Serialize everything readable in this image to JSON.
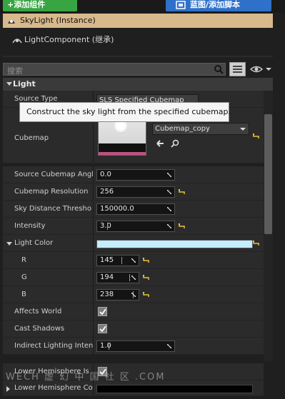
{
  "toolbar": {
    "add_component_label": "+添加组件",
    "blueprint_label": "蓝图/添加脚本"
  },
  "components": [
    {
      "label": "SkyLight (Instance)",
      "icon": "skylight-icon"
    },
    {
      "label": "LightComponent (继承)",
      "icon": "light-component-icon"
    }
  ],
  "search": {
    "placeholder": "搜索"
  },
  "section": {
    "title": "Light"
  },
  "source_type": {
    "label": "Source Type",
    "value": "SLS Specified Cubemap"
  },
  "tooltip": "Construct the sky light from the specified cubemap.",
  "cubemap": {
    "label": "Cubemap",
    "asset": "Cubemap_copy"
  },
  "properties": [
    {
      "label": "Source Cubemap Angl",
      "value": "0.0",
      "reset": false
    },
    {
      "label": "Cubemap Resolution",
      "value": "256",
      "reset": true
    },
    {
      "label": "Sky Distance Thresho",
      "value": "150000.0",
      "reset": false
    },
    {
      "label": "Intensity",
      "value": "3.0",
      "reset": true
    }
  ],
  "light_color": {
    "label": "Light Color",
    "color": "#C2EEFF",
    "channels": [
      {
        "label": "R",
        "value": "145"
      },
      {
        "label": "G",
        "value": "194"
      },
      {
        "label": "B",
        "value": "238"
      }
    ]
  },
  "checks": [
    {
      "label": "Affects World",
      "checked": true
    },
    {
      "label": "Cast Shadows",
      "checked": true
    }
  ],
  "indirect": {
    "label": "Indirect Lighting Inten",
    "value": "1.0"
  },
  "lower_hemi": {
    "label": "Lower Hemisphere Is",
    "checked": true
  },
  "lower_hemi_color": {
    "label": "Lower Hemisphere Colo"
  },
  "watermark": "WECH 虚 幻 中 国 社 区 .COM"
}
